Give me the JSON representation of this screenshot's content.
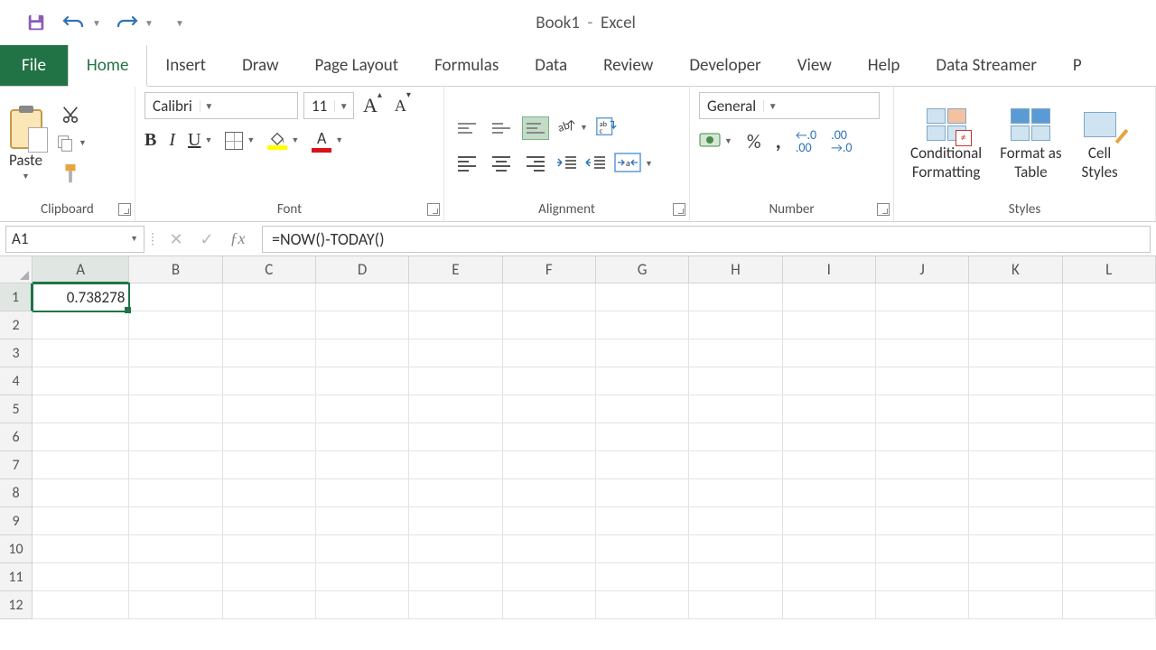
{
  "app": {
    "doc_name": "Book1",
    "separator": "  -  ",
    "app_name": "Excel"
  },
  "qat": {
    "save": "Save",
    "undo": "Undo",
    "redo": "Redo"
  },
  "tabs": {
    "file": "File",
    "home": "Home",
    "insert": "Insert",
    "draw": "Draw",
    "page_layout": "Page Layout",
    "formulas": "Formulas",
    "data": "Data",
    "review": "Review",
    "developer": "Developer",
    "view": "View",
    "help": "Help",
    "data_streamer": "Data Streamer",
    "power_pivot": "P"
  },
  "ribbon": {
    "clipboard": {
      "label": "Clipboard",
      "paste": "Paste"
    },
    "font": {
      "label": "Font",
      "font_name": "Calibri",
      "font_size": "11",
      "bold": "B",
      "italic": "I",
      "underline": "U",
      "font_color_letter": "A"
    },
    "alignment": {
      "label": "Alignment"
    },
    "number": {
      "label": "Number",
      "format": "General",
      "currency": "$",
      "percent": "%",
      "comma": ",",
      "inc_dec": "←.0\n.00",
      "dec_dec": ".00\n→.0"
    },
    "styles": {
      "label": "Styles",
      "conditional": "Conditional\nFormatting",
      "format_table": "Format as\nTable",
      "cell_styles": "Cell\nStyles"
    }
  },
  "formula_bar": {
    "name_box": "A1",
    "formula": "=NOW()-TODAY()"
  },
  "sheet": {
    "columns": [
      "A",
      "B",
      "C",
      "D",
      "E",
      "F",
      "G",
      "H",
      "I",
      "J",
      "K",
      "L"
    ],
    "rows": [
      1,
      2,
      3,
      4,
      5,
      6,
      7,
      8,
      9,
      10,
      11,
      12
    ],
    "active_cell": "A1",
    "cells": {
      "A1": "0.738278"
    }
  }
}
